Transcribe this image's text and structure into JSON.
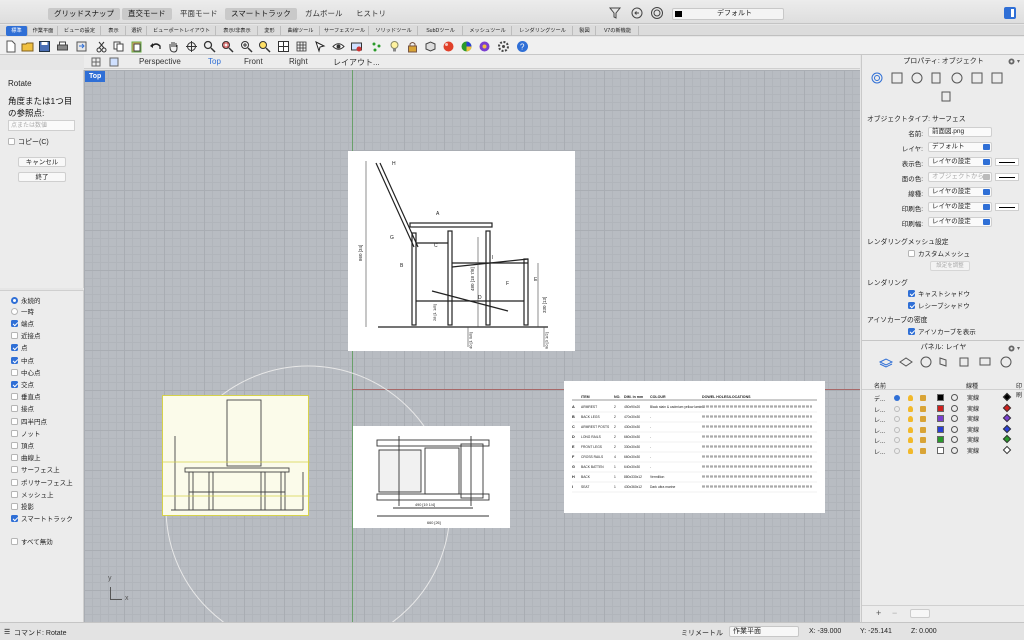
{
  "titlebar": {
    "toggles": [
      {
        "label": "グリッドスナップ",
        "on": true
      },
      {
        "label": "直交モード",
        "on": true
      },
      {
        "label": "平面モード",
        "on": false
      },
      {
        "label": "スマートトラック",
        "on": true
      },
      {
        "label": "ガムボール",
        "on": false
      },
      {
        "label": "ヒストリ",
        "on": false
      }
    ],
    "layer_field": "デフォルト"
  },
  "tabs": [
    "標準",
    "作業平面",
    "ビューの設定",
    "表示",
    "選択",
    "ビューポートレイアウト",
    "表示/非表示",
    "変形",
    "曲線ツール",
    "サーフェスツール",
    "ソリッドツール",
    "SubDツール",
    "メッシュツール",
    "レンダリングツール",
    "製図",
    "V7の新機能"
  ],
  "viewport_header": {
    "tabs": [
      "Perspective",
      "Top",
      "Front",
      "Right",
      "レイアウト..."
    ],
    "active": "Top",
    "label": "Top"
  },
  "command_panel": {
    "command": "Rotate",
    "prompt": "角度または1つ目の参照点:",
    "input_placeholder": "点または数値",
    "copy_option": "コピー(C)",
    "cancel": "キャンセル",
    "finish": "終了"
  },
  "osnap": {
    "persistent": "永続的",
    "one_time": "一時",
    "items": [
      {
        "label": "端点",
        "on": true
      },
      {
        "label": "近接点",
        "on": false
      },
      {
        "label": "点",
        "on": true
      },
      {
        "label": "中点",
        "on": true
      },
      {
        "label": "中心点",
        "on": false
      },
      {
        "label": "交点",
        "on": true
      },
      {
        "label": "垂直点",
        "on": false
      },
      {
        "label": "接点",
        "on": false
      },
      {
        "label": "四半円点",
        "on": false
      },
      {
        "label": "ノット",
        "on": false
      },
      {
        "label": "頂点",
        "on": false
      },
      {
        "label": "曲線上",
        "on": false
      },
      {
        "label": "サーフェス上",
        "on": false
      },
      {
        "label": "ポリサーフェス上",
        "on": false
      },
      {
        "label": "メッシュ上",
        "on": false
      },
      {
        "label": "投影",
        "on": false
      },
      {
        "label": "スマートトラック",
        "on": true
      }
    ],
    "disable_all": "すべて無効"
  },
  "properties": {
    "title": "プロパティ: オブジェクト",
    "object_type_label": "オブジェクトタイプ: サーフェス",
    "rows": [
      {
        "label": "名前:",
        "value": "前面図.png",
        "kind": "text"
      },
      {
        "label": "レイヤ:",
        "value": "デフォルト",
        "kind": "select"
      },
      {
        "label": "表示色:",
        "value": "レイヤの設定",
        "kind": "select-line"
      },
      {
        "label": "面の色:",
        "value": "オブジェクトから",
        "kind": "disabled-line"
      },
      {
        "label": "線種:",
        "value": "レイヤの設定",
        "kind": "select"
      },
      {
        "label": "印刷色:",
        "value": "レイヤの設定",
        "kind": "select-line"
      },
      {
        "label": "印刷幅:",
        "value": "レイヤの設定",
        "kind": "select"
      }
    ],
    "render_mesh_title": "レンダリングメッシュ設定",
    "custom_mesh": "カスタムメッシュ",
    "adjust_button": "設定を調整",
    "rendering_title": "レンダリング",
    "cast_shadows": "キャストシャドウ",
    "receive_shadows": "レシーブシャドウ",
    "isocurve_title": "アイソカーブの密度",
    "show_isocurves": "アイソカーブを表示"
  },
  "layers": {
    "title": "パネル: レイヤ",
    "headers": [
      "名前",
      "線種",
      "印刷"
    ],
    "rows": [
      {
        "name": "デ...",
        "color": "#000000",
        "linetype": "実線",
        "current": true
      },
      {
        "name": "レ...",
        "color": "#d0201e",
        "linetype": "実線",
        "current": false
      },
      {
        "name": "レ...",
        "color": "#7a3fcf",
        "linetype": "実線",
        "current": false
      },
      {
        "name": "レ...",
        "color": "#2a3fd6",
        "linetype": "実線",
        "current": false
      },
      {
        "name": "レ...",
        "color": "#2a9a2a",
        "linetype": "実線",
        "current": false
      },
      {
        "name": "レ...",
        "color": "#ffffff",
        "linetype": "実線",
        "current": false
      }
    ]
  },
  "statusbar": {
    "command": "コマンド: Rotate",
    "units": "ミリメートル",
    "cplane": "作業平面",
    "x": "X: -39.000",
    "y": "Y: -25.141",
    "z": "Z: 0.000"
  },
  "drawing": {
    "letters": [
      "H",
      "A",
      "G",
      "C",
      "B",
      "I",
      "F",
      "E",
      "D"
    ],
    "dim_left": "860 [34]",
    "dim_mid": "480 [18 7/8]",
    "dim_right": "330 [13]",
    "dim_bottom_left": "40 [1 5/8]",
    "dim_bottom_right": "90 [3 1/2]",
    "dim_a": "28 [1 1/8]",
    "plan_w1": "490 [19 1/4]",
    "plan_w2": "660 [26]",
    "table_headers": [
      "ITEM",
      "NO.",
      "DIM. in mm",
      "COLOUR",
      "DOWEL HOLES/LOCATIONS"
    ],
    "table_rows": [
      [
        "A",
        "ARMREST",
        "2",
        "450x90x20",
        "Black stain & cadmium yellow laminar"
      ],
      [
        "B",
        "BACK LEGS",
        "2",
        "470x30x30",
        "-"
      ],
      [
        "C",
        "ARMREST POSTS",
        "2",
        "430x30x30",
        "-"
      ],
      [
        "D",
        "LONG RAILS",
        "2",
        "660x30x30",
        "-"
      ],
      [
        "E",
        "FRONT LEGS",
        "2",
        "330x30x30",
        "-"
      ],
      [
        "F",
        "CROSS RAILS",
        "4",
        "660x30x30",
        "-"
      ],
      [
        "G",
        "BACK BATTEN",
        "1",
        "640x30x30",
        "-"
      ],
      [
        "H",
        "BACK",
        "1",
        "880x330x12",
        "Vermillion"
      ],
      [
        "I",
        "SEAT",
        "1",
        "430x360x12",
        "Dark ultra marine"
      ]
    ]
  }
}
